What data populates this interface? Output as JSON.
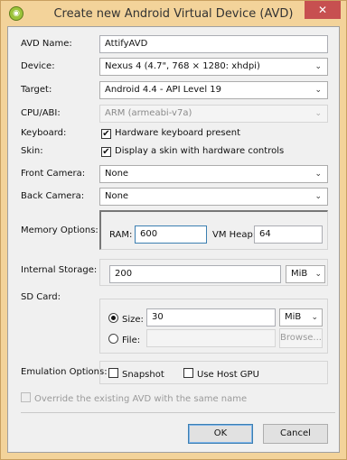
{
  "window": {
    "title": "Create new Android Virtual Device (AVD)",
    "close_glyph": "✕"
  },
  "form": {
    "avd_name": {
      "label": "AVD Name:",
      "value": "AttifyAVD"
    },
    "device": {
      "label": "Device:",
      "value": "Nexus 4 (4.7\", 768 × 1280: xhdpi)"
    },
    "target": {
      "label": "Target:",
      "value": "Android 4.4 - API Level 19"
    },
    "cpu_abi": {
      "label": "CPU/ABI:",
      "value": "ARM (armeabi-v7a)"
    },
    "keyboard": {
      "label": "Keyboard:",
      "option": "Hardware keyboard present",
      "checked": true
    },
    "skin": {
      "label": "Skin:",
      "option": "Display a skin with hardware controls",
      "checked": true
    },
    "front_camera": {
      "label": "Front Camera:",
      "value": "None"
    },
    "back_camera": {
      "label": "Back Camera:",
      "value": "None"
    },
    "memory": {
      "label": "Memory Options:",
      "ram_label": "RAM:",
      "ram_value": "600",
      "heap_label": "VM Heap:",
      "heap_value": "64"
    },
    "internal_storage": {
      "label": "Internal Storage:",
      "value": "200",
      "unit": "MiB"
    },
    "sd_card": {
      "label": "SD Card:",
      "size_label": "Size:",
      "size_value": "30",
      "size_unit": "MiB",
      "file_label": "File:",
      "file_value": "",
      "browse_label": "Browse..."
    },
    "emulation": {
      "label": "Emulation Options:",
      "snapshot": "Snapshot",
      "host_gpu": "Use Host GPU"
    },
    "override": {
      "label": "Override the existing AVD with the same name"
    }
  },
  "buttons": {
    "ok": "OK",
    "cancel": "Cancel"
  },
  "glyphs": {
    "chevron": "⌄",
    "check": "✔"
  },
  "colors": {
    "title_bar": "#f3d39a",
    "close": "#c75050",
    "focus": "#3c7fb1"
  }
}
